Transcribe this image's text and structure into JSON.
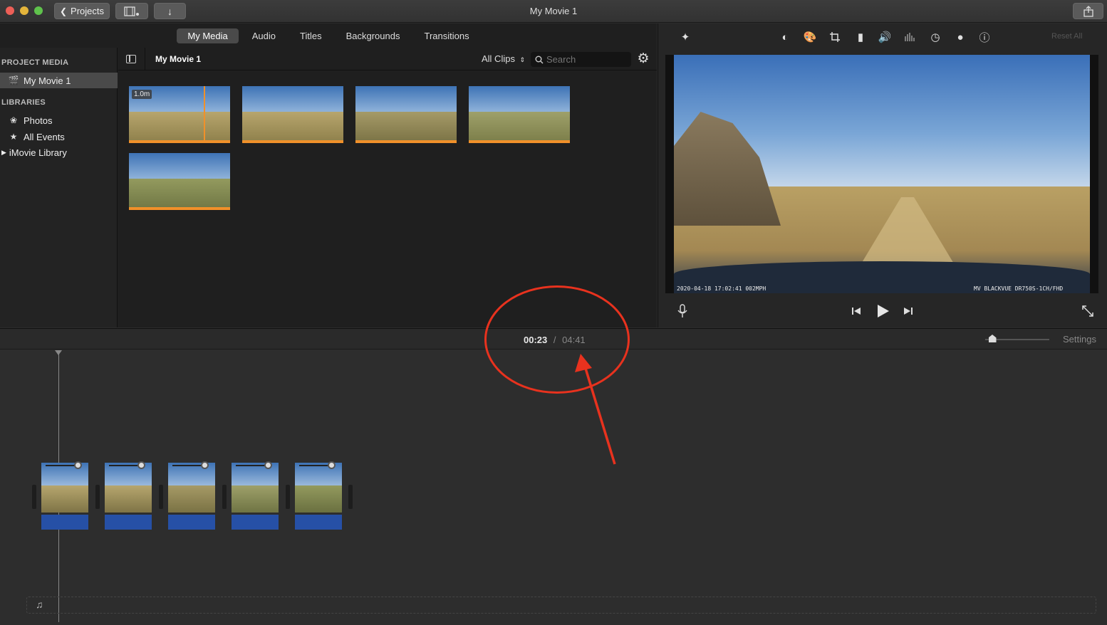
{
  "window": {
    "title": "My Movie 1"
  },
  "toolbar": {
    "projects_label": "Projects"
  },
  "tabs": [
    "My Media",
    "Audio",
    "Titles",
    "Backgrounds",
    "Transitions"
  ],
  "sidebar": {
    "project_media_header": "PROJECT MEDIA",
    "project_item": "My Movie 1",
    "libraries_header": "LIBRARIES",
    "library_items": [
      "Photos",
      "All Events",
      "iMovie Library"
    ]
  },
  "browser": {
    "title": "My Movie 1",
    "filter": "All Clips",
    "search_placeholder": "Search",
    "first_clip_badge": "1.0m"
  },
  "viewer": {
    "reset_label": "Reset All",
    "overlay_left": "2020-04-18 17:02:41  002MPH",
    "overlay_right": "MV  BLACKVUE DR750S-1CH/FHD"
  },
  "timeline": {
    "current_time": "00:23",
    "separator": "/",
    "total_time": "04:41",
    "settings_label": "Settings",
    "zoom_level": 0.05
  },
  "annotation": {
    "color": "#e8321e"
  }
}
